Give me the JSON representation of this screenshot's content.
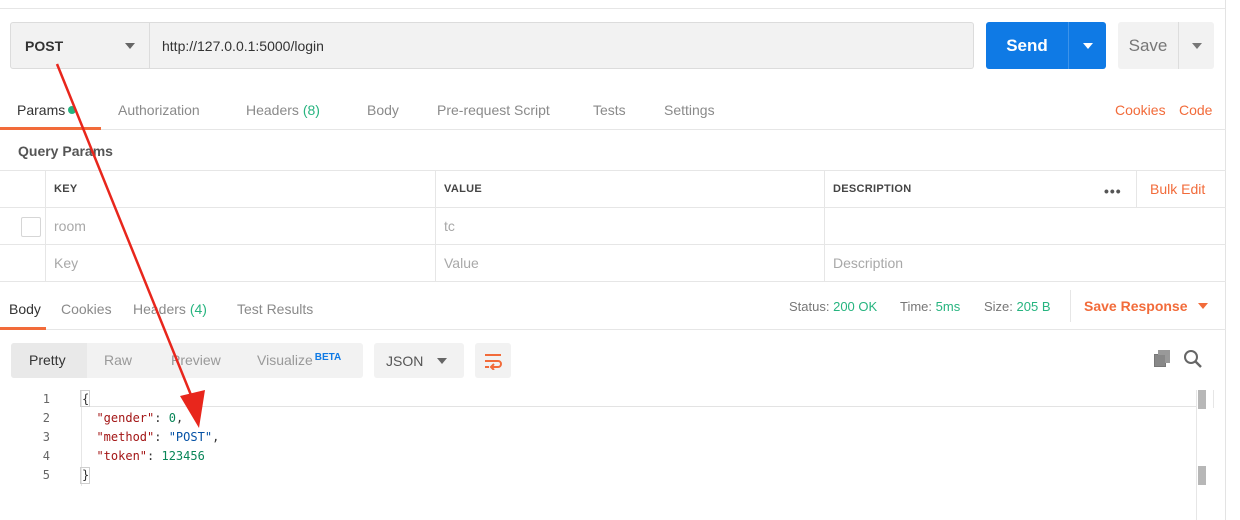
{
  "request": {
    "method": "POST",
    "url": "http://127.0.0.1:5000/login",
    "send_label": "Send",
    "save_label": "Save"
  },
  "request_tabs": {
    "params": "Params",
    "authorization": "Authorization",
    "headers": "Headers",
    "headers_count": "(8)",
    "body": "Body",
    "prerequest": "Pre-request Script",
    "tests": "Tests",
    "settings": "Settings",
    "cookies": "Cookies",
    "code": "Code"
  },
  "query_params": {
    "title": "Query Params",
    "columns": {
      "key": "KEY",
      "value": "VALUE",
      "description": "DESCRIPTION"
    },
    "more": "•••",
    "bulk_edit": "Bulk Edit",
    "rows": [
      {
        "key": "room",
        "value": "tc"
      }
    ],
    "placeholders": {
      "key": "Key",
      "value": "Value",
      "description": "Description"
    }
  },
  "response_tabs": {
    "body": "Body",
    "cookies": "Cookies",
    "headers": "Headers",
    "headers_count": "(4)",
    "test_results": "Test Results"
  },
  "response_status": {
    "status_label": "Status:",
    "status_value": "200 OK",
    "time_label": "Time:",
    "time_value": "5ms",
    "size_label": "Size:",
    "size_value": "205 B",
    "save_response": "Save Response"
  },
  "view": {
    "pretty": "Pretty",
    "raw": "Raw",
    "preview": "Preview",
    "visualize": "Visualize",
    "beta": "BETA",
    "format": "JSON"
  },
  "code": {
    "line_numbers": [
      "1",
      "2",
      "3",
      "4",
      "5"
    ],
    "open_brace": "{",
    "close_brace": "}",
    "lines": [
      {
        "key": "\"gender\"",
        "sep": ": ",
        "value": "0",
        "comma": ","
      },
      {
        "key": "\"method\"",
        "sep": ": ",
        "value": "\"POST\"",
        "comma": ","
      },
      {
        "key": "\"token\"",
        "sep": ": ",
        "value": "123456",
        "comma": ""
      }
    ]
  },
  "colors": {
    "accent": "#f26b3a",
    "send": "#0f7ae5",
    "success": "#26b47f",
    "annotation_arrow": "#e8261c"
  }
}
